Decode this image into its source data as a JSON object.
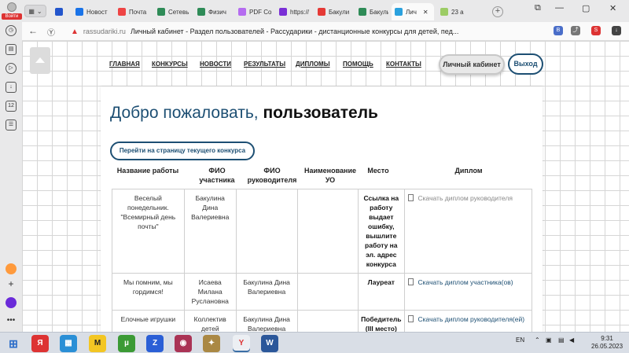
{
  "browser": {
    "profile_label": "Войти",
    "tabs": [
      {
        "label": "",
        "color": "#2255cc"
      },
      {
        "label": "Новост",
        "color": "#1a73e8"
      },
      {
        "label": "Почта",
        "color": "#ee4444"
      },
      {
        "label": "Сетевь",
        "color": "#2e8b57"
      },
      {
        "label": "Физич",
        "color": "#2e8b57"
      },
      {
        "label": "PDF Co",
        "color": "#b56cf0"
      },
      {
        "label": "https://",
        "color": "#7a2fd6"
      },
      {
        "label": "Бакули",
        "color": "#e53935"
      },
      {
        "label": "Бакули",
        "color": "#2e8b57"
      },
      {
        "label": "Лич",
        "color": "#2aa1de"
      },
      {
        "label": "23 а",
        "color": "#9ccc65"
      }
    ],
    "url_domain": "rassudariki.ru",
    "page_title": "Личный кабинет - Раздел пользователей - Рассударики - дистанционные конкурсы для детей, пед..."
  },
  "nav": {
    "items": [
      "ГЛАВНАЯ",
      "КОНКУРСЫ",
      "НОВОСТИ",
      "РЕЗУЛЬТАТЫ",
      "ДИПЛОМЫ",
      "ПОМОЩЬ",
      "КОНТАКТЫ"
    ],
    "cabinet": "Личный кабинет",
    "exit": "Выход"
  },
  "main": {
    "welcome": "Добро пожаловать,",
    "username": "пользователь",
    "contest_button": "Перейти на страницу текущего конкурса"
  },
  "table": {
    "headers": [
      "Название работы",
      "ФИО участника",
      "ФИО руководителя",
      "Наименование УО",
      "Место",
      "Диплом"
    ],
    "rows": [
      {
        "work": "Веселый понедельник. \"Всемирный день почты\"",
        "participant": "Бакулина Дина Валериевна",
        "supervisor": "",
        "org": "",
        "place": "Ссылка на работу выдает ошибку, вышлите работу на эл. адрес конкурса",
        "diploma": "Скачать диплом руководителя",
        "diploma_active": false
      },
      {
        "work": "Мы помним, мы гордимся!",
        "participant": "Исаева Милана Руслановна",
        "supervisor": "Бакулина Дина Валериевна",
        "org": "",
        "place": "Лауреат",
        "diploma": "Скачать диплом участника(ов)",
        "diploma_active": true
      },
      {
        "work": "Елочные игрушки",
        "participant": "Коллектив детей",
        "supervisor": "Бакулина Дина Валериевна",
        "org": "",
        "place": "Победитель (III место)",
        "diploma": "Скачать диплом руководителя(ей)",
        "diploma_active": true
      }
    ]
  },
  "taskbar": {
    "lang": "EN",
    "time": "9:31",
    "date": "26.05.2023"
  }
}
